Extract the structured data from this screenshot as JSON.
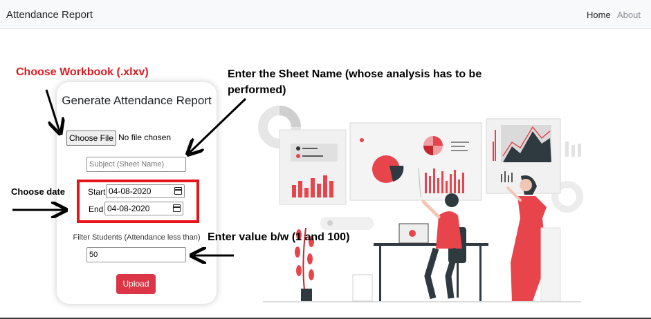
{
  "navbar": {
    "brand": "Attendance Report",
    "links": [
      {
        "label": "Home",
        "active": true
      },
      {
        "label": "About",
        "active": false
      }
    ]
  },
  "form": {
    "title": "Generate Attendance Report",
    "file_button": "Choose File",
    "file_status": "No file chosen",
    "subject_placeholder": "Subject (Sheet Name)",
    "subject_value": "",
    "start_label": "Start",
    "start_value": "04-08-2020",
    "end_label": "End",
    "end_value": "04-08-2020",
    "filter_label": "Filter Students (Attendance less than)",
    "filter_value": "50",
    "upload_label": "Upload"
  },
  "annotations": {
    "workbook": "Choose Workbook (.xlxv)",
    "sheet": "Enter the Sheet Name (whose analysis has to be performed)",
    "date": "Choose date",
    "value": "Enter value b/w (1 and 100)"
  },
  "icons": [
    "calendar-icon",
    "arrow-icon",
    "analytics-illustration"
  ],
  "colors": {
    "accent": "#dc3545",
    "annotation_red": "#e0191f",
    "highlight_box": "#e8141c",
    "illustration_red": "#e8444b"
  }
}
